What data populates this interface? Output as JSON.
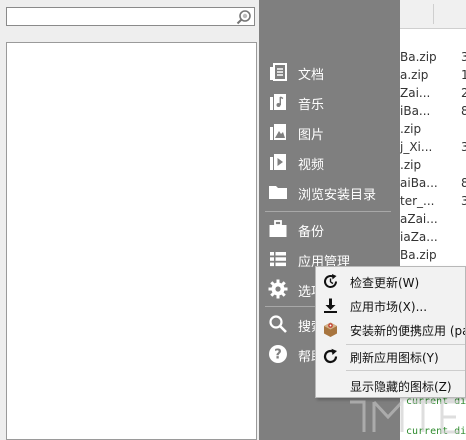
{
  "search": {
    "placeholder": ""
  },
  "launcher": {
    "items": [
      {
        "label": "文档",
        "icon": "documents-icon"
      },
      {
        "label": "音乐",
        "icon": "music-icon"
      },
      {
        "label": "图片",
        "icon": "pictures-icon"
      },
      {
        "label": "视频",
        "icon": "video-icon"
      },
      {
        "label": "浏览安装目录",
        "icon": "folder-icon"
      },
      {
        "label": "备份",
        "icon": "briefcase-icon"
      },
      {
        "label": "应用管理",
        "icon": "list-icon"
      },
      {
        "label": "选项",
        "icon": "gear-icon"
      },
      {
        "label": "搜索",
        "icon": "search-icon"
      },
      {
        "label": "帮助",
        "icon": "help-icon"
      }
    ]
  },
  "context_menu": {
    "items": [
      {
        "label": "检查更新(W)",
        "icon": "refresh-update-icon"
      },
      {
        "label": "应用市场(X)...",
        "icon": "download-icon"
      },
      {
        "label": "安装新的便携应用 (pa",
        "icon": "package-icon"
      },
      {
        "label": "刷新应用图标(Y)",
        "icon": "refresh-icon"
      },
      {
        "label": "显示隐藏的图标(Z)",
        "icon": ""
      }
    ]
  },
  "background_files": {
    "rows": [
      {
        "name": "Ba.zip",
        "size": "3"
      },
      {
        "name": "a.zip",
        "size": "1"
      },
      {
        "name": "Zai...",
        "size": "2"
      },
      {
        "name": "iBa...",
        "size": "8"
      },
      {
        "name": ".zip",
        "size": ""
      },
      {
        "name": "j_Xi...",
        "size": "3"
      },
      {
        "name": ".zip",
        "size": ""
      },
      {
        "name": "aiBa...",
        "size": "8"
      },
      {
        "name": "ter_...",
        "size": "3"
      },
      {
        "name": "aZai...",
        "size": ""
      },
      {
        "name": "iaZa...",
        "size": ""
      },
      {
        "name": "Ba.zip",
        "size": ""
      }
    ],
    "console": [
      "current dir",
      "current dir"
    ]
  },
  "colors": {
    "launcher_bg": "#7f7f7f",
    "context_bg": "#f2f2f2",
    "console_text": "#2e8b2e"
  }
}
